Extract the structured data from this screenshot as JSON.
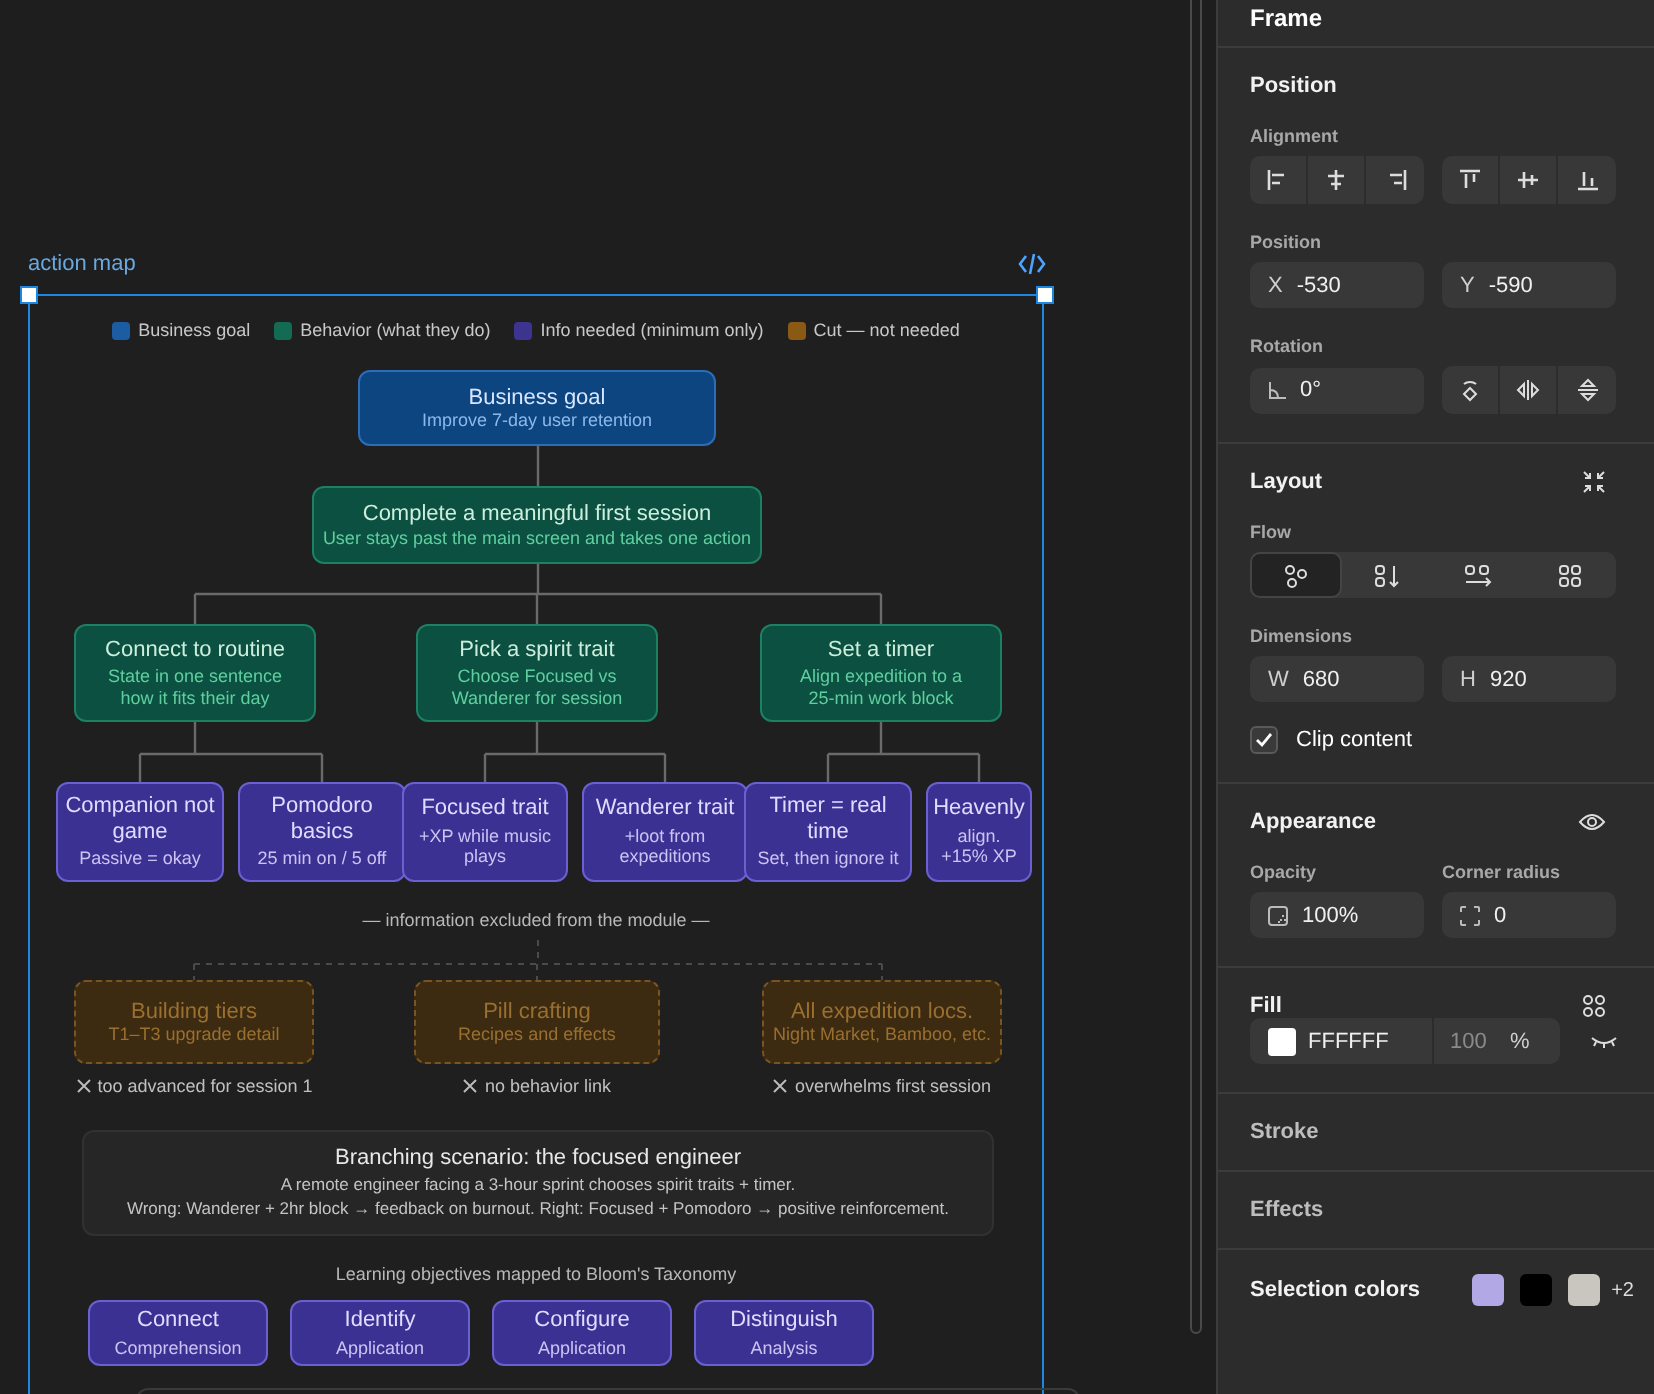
{
  "canvas": {
    "frame_label": "action map",
    "legend": [
      {
        "label": "Business goal",
        "color": "#1b5ca3"
      },
      {
        "label": "Behavior (what they do)",
        "color": "#136b53"
      },
      {
        "label": "Info needed (minimum only)",
        "color": "#3c348f"
      },
      {
        "label": "Cut — not needed",
        "color": "#8a5a14"
      }
    ],
    "goal": {
      "title": "Business goal",
      "subtitle": "Improve 7-day user retention"
    },
    "behavior": {
      "title": "Complete a meaningful first session",
      "subtitle": "User stays past the main screen and takes one action"
    },
    "actions": [
      {
        "title": "Connect to routine",
        "subtitle": "State in one sentence how it fits their day",
        "info": [
          {
            "title": "Companion not game",
            "subtitle": "Passive = okay"
          },
          {
            "title": "Pomodoro basics",
            "subtitle": "25 min on / 5 off"
          }
        ]
      },
      {
        "title": "Pick a spirit trait",
        "subtitle": "Choose Focused vs Wanderer for session",
        "info": [
          {
            "title": "Focused trait",
            "subtitle": "+XP while music plays"
          },
          {
            "title": "Wanderer trait",
            "subtitle": "+loot from expeditions"
          }
        ]
      },
      {
        "title": "Set a timer",
        "subtitle": "Align expedition to a 25-min work block",
        "info": [
          {
            "title": "Timer = real time",
            "subtitle": "Set, then ignore it"
          },
          {
            "title": "Heavenly",
            "subtitle": "align. +15% XP"
          }
        ]
      }
    ],
    "excluded_label": "— information excluded from the module —",
    "excluded": [
      {
        "title": "Building tiers",
        "subtitle": "T1–T3 upgrade detail",
        "reason": "too advanced for session 1"
      },
      {
        "title": "Pill crafting",
        "subtitle": "Recipes and effects",
        "reason": "no behavior link"
      },
      {
        "title": "All expedition locs.",
        "subtitle": "Night Market, Bamboo, etc.",
        "reason": "overwhelms first session"
      }
    ],
    "scenario": {
      "title": "Branching scenario: the focused engineer",
      "lines": [
        "A remote engineer facing a 3-hour sprint chooses spirit traits + timer.",
        "Wrong: Wanderer + 2hr block → feedback on burnout. Right: Focused + Pomodoro → positive reinforcement."
      ]
    },
    "objectives_title": "Learning objectives mapped to Bloom's Taxonomy",
    "objectives": [
      {
        "verb": "Connect",
        "level": "Comprehension"
      },
      {
        "verb": "Identify",
        "level": "Application"
      },
      {
        "verb": "Configure",
        "level": "Application"
      },
      {
        "verb": "Distinguish",
        "level": "Analysis"
      }
    ]
  },
  "panel": {
    "header": "Frame",
    "position": {
      "title": "Position",
      "alignment_label": "Alignment",
      "position_label": "Position",
      "x": {
        "label": "X",
        "value": "-530"
      },
      "y": {
        "label": "Y",
        "value": "-590"
      },
      "rotation_label": "Rotation",
      "rotation": "0°"
    },
    "layout": {
      "title": "Layout",
      "flow_label": "Flow",
      "flow_options": [
        {
          "kind": "free",
          "selected": true
        },
        {
          "kind": "vertical",
          "selected": false
        },
        {
          "kind": "horizontal",
          "selected": false
        },
        {
          "kind": "grid",
          "selected": false
        }
      ],
      "dimensions_label": "Dimensions",
      "w": {
        "label": "W",
        "value": "680"
      },
      "h": {
        "label": "H",
        "value": "920"
      },
      "clip": {
        "label": "Clip content",
        "checked": true
      }
    },
    "appearance": {
      "title": "Appearance",
      "opacity_label": "Opacity",
      "opacity": "100%",
      "radius_label": "Corner radius",
      "radius": "0"
    },
    "fill": {
      "title": "Fill",
      "color": "#ffffff",
      "hex": "FFFFFF",
      "opacity": "100",
      "unit": "%"
    },
    "stroke": {
      "title": "Stroke"
    },
    "effects": {
      "title": "Effects"
    },
    "selection_colors": {
      "title": "Selection colors",
      "swatches": [
        {
          "color": "#b3a8e6"
        },
        {
          "color": "#000000"
        },
        {
          "color": "#c8c6bf"
        }
      ],
      "more": "+2"
    }
  }
}
